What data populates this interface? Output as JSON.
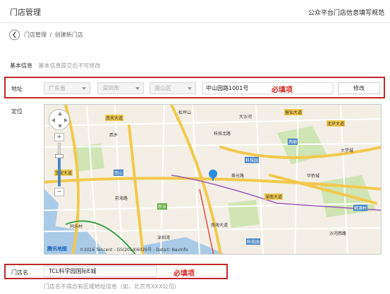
{
  "header": {
    "title": "门店管理",
    "right_link": "公众平台门店信息填写规范"
  },
  "breadcrumb": {
    "back_icon": "arrow-left-icon",
    "parent": "门店管理",
    "separator": "/",
    "current": "创建新门店"
  },
  "basic_info": {
    "label": "基本信息",
    "hint": "基本信息提交后不可修改"
  },
  "address": {
    "label": "地址",
    "province": "广东省",
    "city": "深圳市",
    "district": "南山区",
    "street_value": "中山园路1001号",
    "required_text": "必填项",
    "modify_label": "修改"
  },
  "location": {
    "label": "定位",
    "map_copyright": "©2016 Tencent - GS(2014)6026号 - Data© NavInfo",
    "map_logo": "腾讯地图",
    "zoom_in": "+",
    "zoom_out": "−",
    "zoom_level_fraction": 0.7,
    "labels": {
      "l1": "南天大道",
      "l2": "松坪山",
      "l3": "科技北路",
      "l4": "西乡",
      "l5": "深圳湾",
      "l6": "南山",
      "l7": "科技园",
      "l8": "大沙河",
      "l9": "西丽",
      "l10": "留仙大道",
      "l11": "茶光路",
      "l12": "深南大道",
      "l13": "新安",
      "l14": "宝安大道",
      "l15": "桃源村",
      "l16": "华侨城",
      "l17": "科技园",
      "l18": "北环大道",
      "l19": "前海路",
      "l20": "沙河西路",
      "l21": "南海大道",
      "l22": "大学城",
      "l23": "同乐村"
    }
  },
  "store_name": {
    "label": "门店名",
    "value": "TCL科学园国际E城",
    "required_text": "必填项",
    "hint": "门店名不得含有区域地址信息（如，北京市XXX公司）"
  },
  "colors": {
    "highlight_border": "#c0282b",
    "required_text": "#d7261f",
    "map_background": "#f3efe6",
    "road_major": "#f2c94c",
    "water": "#a9cbe8",
    "park": "#cfe5b4",
    "pin": "#2a8de0"
  }
}
